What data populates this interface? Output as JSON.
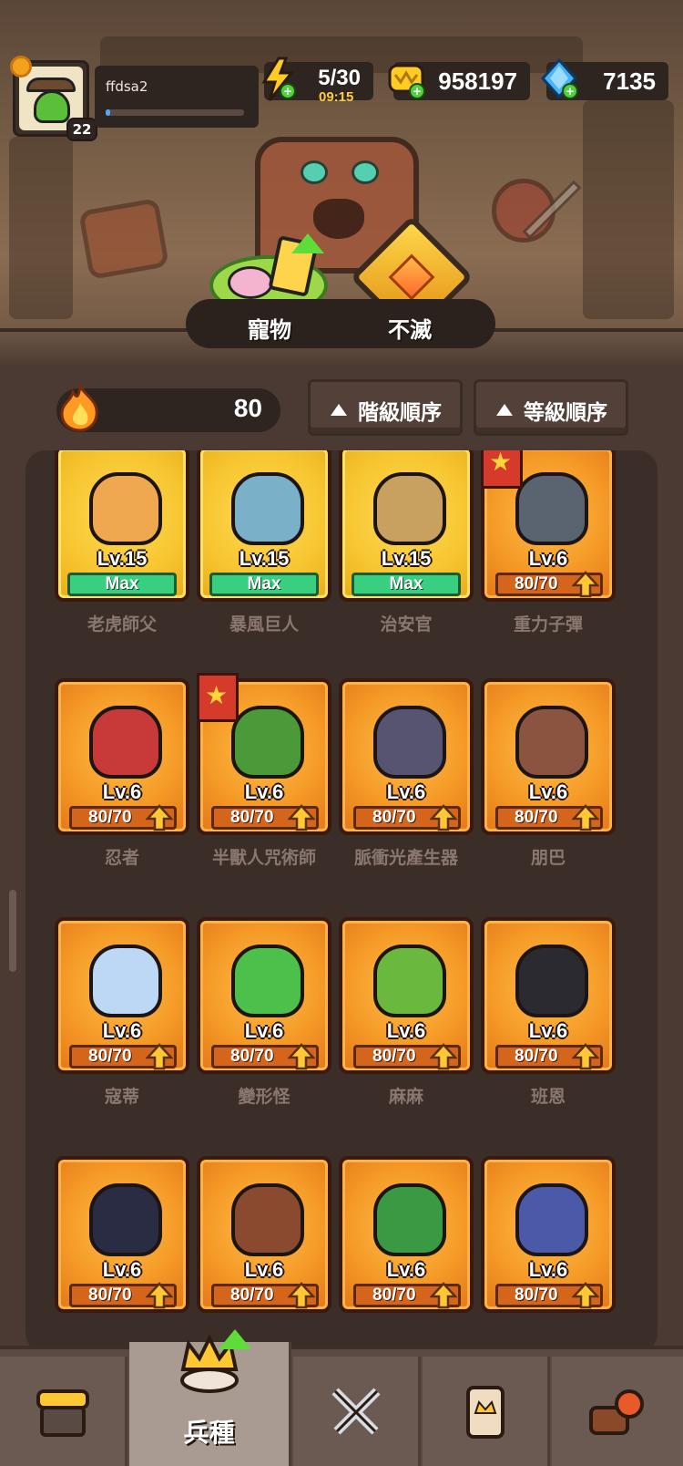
{
  "player": {
    "name": "ffdsa2",
    "level": "22",
    "xp_fraction": 0.03
  },
  "resources": {
    "energy": "5/30",
    "energy_timer": "09:15",
    "gold": "958197",
    "gems": "7135"
  },
  "modes": {
    "pet_label": "寵物",
    "immortal_label": "不滅"
  },
  "power": "80",
  "sort": {
    "rank_label": "階級順序",
    "level_label": "等級順序"
  },
  "units": [
    {
      "name": "老虎師父",
      "level": "Lv.15",
      "progress": "Max",
      "max": true,
      "gold": true,
      "flag": false,
      "color": "#f0a850"
    },
    {
      "name": "暴風巨人",
      "level": "Lv.15",
      "progress": "Max",
      "max": true,
      "gold": true,
      "flag": false,
      "color": "#7ab0c8"
    },
    {
      "name": "治安官",
      "level": "Lv.15",
      "progress": "Max",
      "max": true,
      "gold": true,
      "flag": false,
      "color": "#c8a060"
    },
    {
      "name": "重力子彈",
      "level": "Lv.6",
      "progress": "80/70",
      "max": false,
      "gold": false,
      "flag": true,
      "color": "#5a6470"
    },
    {
      "name": "忍者",
      "level": "Lv.6",
      "progress": "80/70",
      "max": false,
      "gold": false,
      "flag": false,
      "color": "#c83a3a"
    },
    {
      "name": "半獸人咒術師",
      "level": "Lv.6",
      "progress": "80/70",
      "max": false,
      "gold": false,
      "flag": true,
      "color": "#4a9a3a"
    },
    {
      "name": "脈衝光產生器",
      "level": "Lv.6",
      "progress": "80/70",
      "max": false,
      "gold": false,
      "flag": false,
      "color": "#565470"
    },
    {
      "name": "朋巴",
      "level": "Lv.6",
      "progress": "80/70",
      "max": false,
      "gold": false,
      "flag": false,
      "color": "#8a5440"
    },
    {
      "name": "寇蒂",
      "level": "Lv.6",
      "progress": "80/70",
      "max": false,
      "gold": false,
      "flag": false,
      "color": "#bcd8f4"
    },
    {
      "name": "變形怪",
      "level": "Lv.6",
      "progress": "80/70",
      "max": false,
      "gold": false,
      "flag": false,
      "color": "#4cc04a"
    },
    {
      "name": "麻麻",
      "level": "Lv.6",
      "progress": "80/70",
      "max": false,
      "gold": false,
      "flag": false,
      "color": "#6ab83e"
    },
    {
      "name": "班恩",
      "level": "Lv.6",
      "progress": "80/70",
      "max": false,
      "gold": false,
      "flag": false,
      "color": "#2a2a30"
    },
    {
      "name": "",
      "level": "Lv.6",
      "progress": "80/70",
      "max": false,
      "gold": false,
      "flag": false,
      "color": "#2a2c44"
    },
    {
      "name": "",
      "level": "Lv.6",
      "progress": "80/70",
      "max": false,
      "gold": false,
      "flag": false,
      "color": "#8a4a30"
    },
    {
      "name": "",
      "level": "Lv.6",
      "progress": "80/70",
      "max": false,
      "gold": false,
      "flag": false,
      "color": "#3a9a44"
    },
    {
      "name": "",
      "level": "Lv.6",
      "progress": "80/70",
      "max": false,
      "gold": false,
      "flag": false,
      "color": "#4a5aa8"
    }
  ],
  "nav": {
    "active_label": "兵種",
    "tabs": [
      "shop-icon",
      "crown-icon",
      "crossed-swords-icon",
      "card-icon",
      "chest-icon"
    ]
  },
  "colors": {
    "accent_orange": "#f59a27",
    "max_green": "#38d07e",
    "gold_card": "#f7c530",
    "timer_yellow": "#ffcf33"
  }
}
